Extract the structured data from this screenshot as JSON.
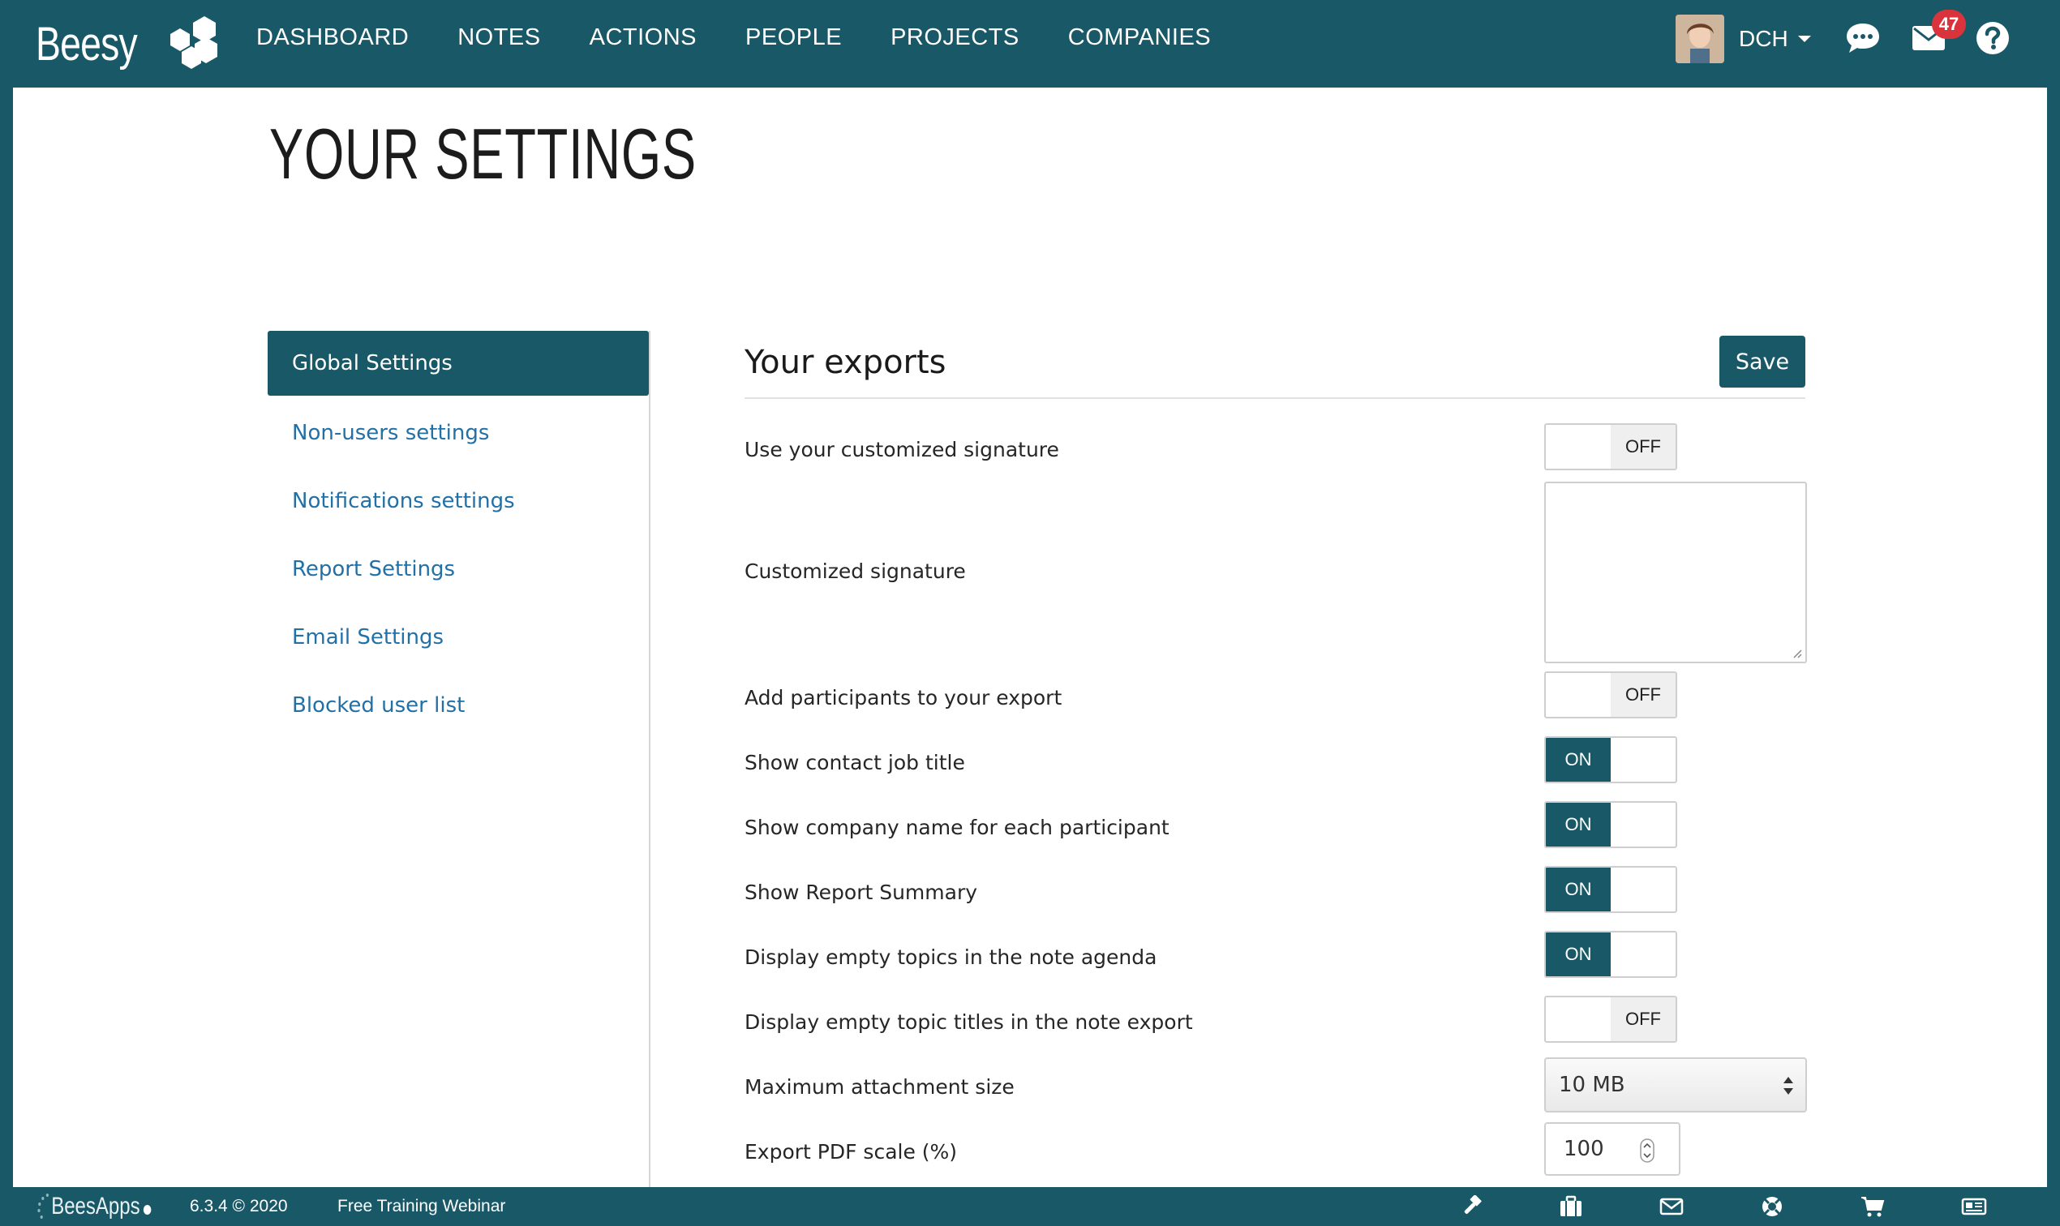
{
  "brand": {
    "logo_text": "Beesy"
  },
  "nav": {
    "items": [
      "DASHBOARD",
      "NOTES",
      "ACTIONS",
      "PEOPLE",
      "PROJECTS",
      "COMPANIES"
    ]
  },
  "user": {
    "initials": "DCH",
    "mail_count": "47"
  },
  "page": {
    "title": "YOUR SETTINGS"
  },
  "sidebar": {
    "items": [
      {
        "label": "Global Settings",
        "active": true
      },
      {
        "label": "Non-users settings"
      },
      {
        "label": "Notifications settings"
      },
      {
        "label": "Report Settings"
      },
      {
        "label": "Email Settings"
      },
      {
        "label": "Blocked user list"
      }
    ]
  },
  "content": {
    "section_title": "Your exports",
    "save_label": "Save",
    "rows": [
      {
        "label": "Use your customized signature",
        "control": "toggle",
        "state": "OFF"
      },
      {
        "label": "Customized signature",
        "control": "textarea",
        "value": ""
      },
      {
        "label": "Add participants to your export",
        "control": "toggle",
        "state": "OFF"
      },
      {
        "label": "Show contact job title",
        "control": "toggle",
        "state": "ON"
      },
      {
        "label": "Show company name for each participant",
        "control": "toggle",
        "state": "ON"
      },
      {
        "label": "Show Report Summary",
        "control": "toggle",
        "state": "ON"
      },
      {
        "label": "Display empty topics in the note agenda",
        "control": "toggle",
        "state": "ON"
      },
      {
        "label": "Display empty topic titles in the note export",
        "control": "toggle",
        "state": "OFF"
      },
      {
        "label": "Maximum attachment size",
        "control": "select",
        "value": "10 MB"
      },
      {
        "label": "Export PDF scale (%)",
        "control": "number",
        "value": "100"
      }
    ]
  },
  "footer": {
    "logo_text": "BeesApps",
    "version": "6.3.4 © 2020",
    "link": "Free Training Webinar",
    "icons": [
      "hammer-icon",
      "briefcase-icon",
      "envelope-icon",
      "lifebuoy-icon",
      "cart-icon",
      "newspaper-icon"
    ]
  },
  "colors": {
    "primary": "#195867",
    "link": "#2270a5",
    "badge": "#d9343b"
  }
}
